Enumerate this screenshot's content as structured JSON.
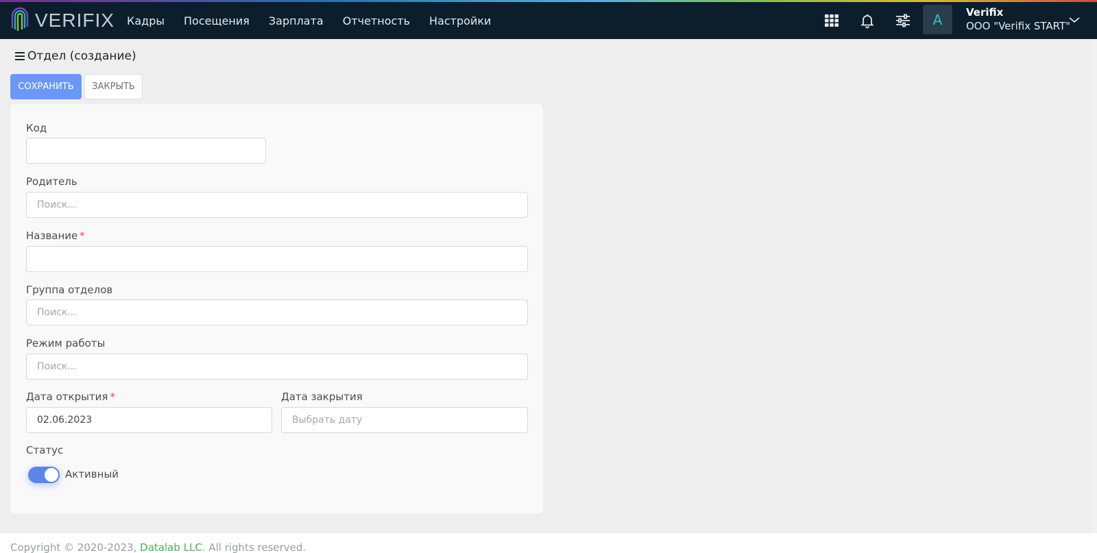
{
  "brand": {
    "name": "VERIFIX"
  },
  "nav": {
    "items": [
      "Кадры",
      "Посещения",
      "Зарплата",
      "Отчетность",
      "Настройки"
    ]
  },
  "toolbar_icons": [
    "grid-icon",
    "bell-icon",
    "sliders-icon"
  ],
  "user": {
    "avatar_letter": "A",
    "name": "Verifix",
    "org": "ООО \"Verifix START\""
  },
  "page": {
    "title": "Отдел (создание)"
  },
  "actions": {
    "save_label": "СОХРАНИТЬ",
    "close_label": "ЗАКРЫТЬ"
  },
  "form": {
    "code": {
      "label": "Код",
      "value": ""
    },
    "parent": {
      "label": "Родитель",
      "placeholder": "Поиск..."
    },
    "name": {
      "label": "Название",
      "required_mark": "*",
      "value": ""
    },
    "division_group": {
      "label": "Группа отделов",
      "placeholder": "Поиск..."
    },
    "schedule": {
      "label": "Режим работы",
      "placeholder": "Поиск..."
    },
    "opened_date": {
      "label": "Дата открытия",
      "required_mark": "*",
      "value": "02.06.2023"
    },
    "closed_date": {
      "label": "Дата закрытия",
      "placeholder": "Выбрать дату"
    },
    "status": {
      "label": "Статус",
      "value_label": "Активный",
      "enabled": true
    }
  },
  "footer": {
    "prefix": "Copyright © 2020-2023, ",
    "company": "Datalab LLC",
    "suffix": ". All rights reserved."
  },
  "colors": {
    "topbar": "#0c1e2c",
    "primary": "#6b98f7",
    "toggle": "#5b86e5",
    "required": "#e8434f",
    "link": "#4caf50"
  }
}
